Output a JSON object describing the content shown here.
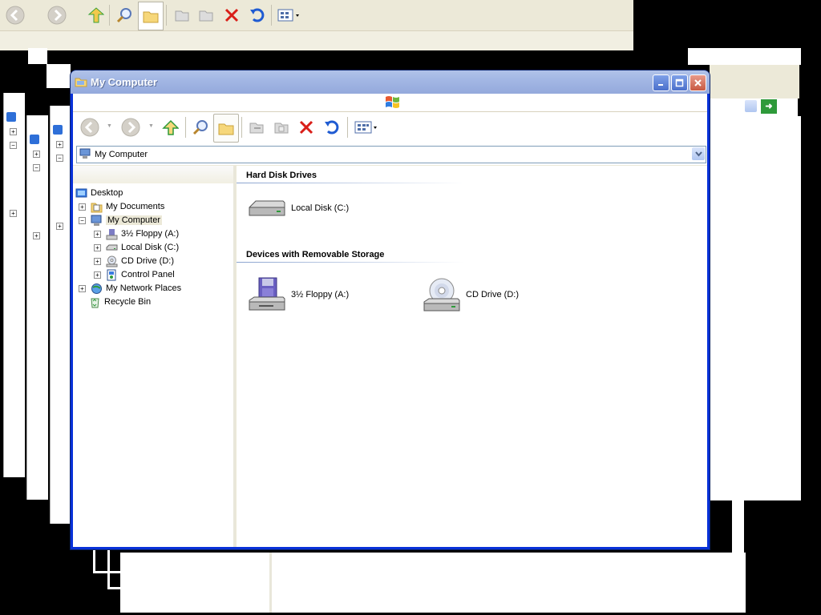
{
  "window": {
    "title": "My Computer",
    "colors": {
      "title_gradient_start": "#b0c2e8",
      "title_gradient_end": "#94a9dc",
      "client_bg": "#ece9d8"
    }
  },
  "toolbar": {
    "buttons": [
      "back-icon",
      "forward-icon",
      "up-icon",
      "search-icon",
      "folders-icon",
      "move-to-icon",
      "copy-to-icon",
      "delete-icon",
      "undo-icon",
      "views-icon"
    ]
  },
  "address": {
    "value": "My Computer"
  },
  "tree": {
    "items": [
      {
        "label": "Desktop",
        "icon": "desktop-icon"
      },
      {
        "label": "My Documents",
        "icon": "documents-icon"
      },
      {
        "label": "My Computer",
        "icon": "computer-icon"
      },
      {
        "label": "3½ Floppy (A:)",
        "icon": "floppy-icon"
      },
      {
        "label": "Local Disk (C:)",
        "icon": "harddisk-icon"
      },
      {
        "label": "CD Drive (D:)",
        "icon": "cdrom-icon"
      },
      {
        "label": "Control Panel",
        "icon": "control-panel-icon"
      },
      {
        "label": "My Network Places",
        "icon": "network-icon"
      },
      {
        "label": "Recycle Bin",
        "icon": "recycle-bin-icon"
      }
    ]
  },
  "content": {
    "groups": [
      {
        "title": "Hard Disk Drives",
        "items": [
          {
            "label": "Local Disk (C:)"
          }
        ]
      },
      {
        "title": "Devices with Removable Storage",
        "items": [
          {
            "label": "3½ Floppy (A:)"
          },
          {
            "label": "CD Drive (D:)"
          }
        ]
      }
    ]
  }
}
